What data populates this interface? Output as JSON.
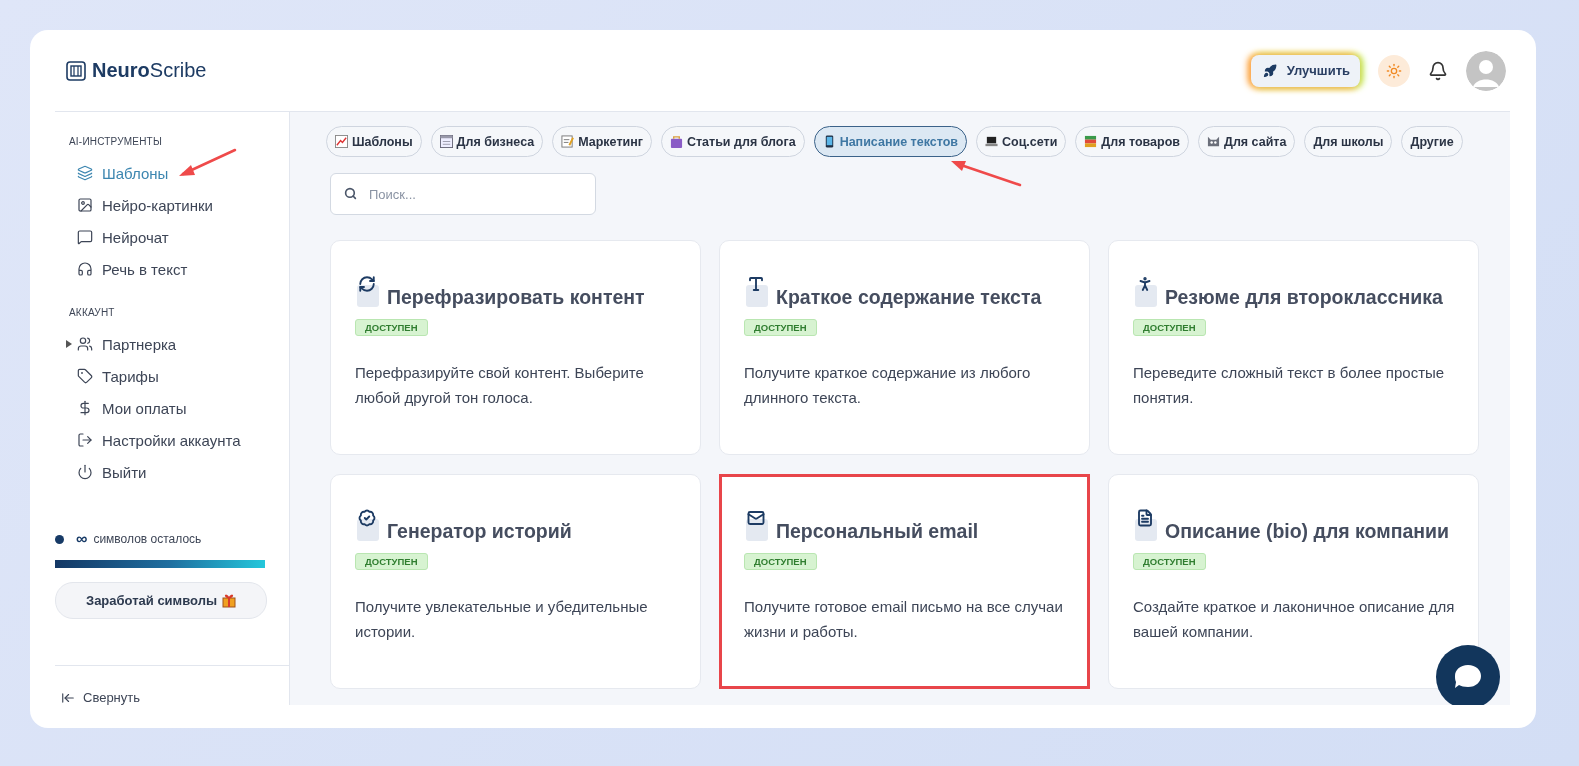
{
  "header": {
    "logo": "**Neuro**Scribe",
    "upgrade_button": "Улучшить"
  },
  "sidebar": {
    "sections": [
      {
        "title": "AI-ИНСТРУМЕНТЫ",
        "items": [
          {
            "label": "Шаблоны",
            "selected": true,
            "annotated": true
          },
          {
            "label": "Нейро-картинки",
            "selected": false,
            "annotated": false
          },
          {
            "label": "Нейрочат",
            "selected": false,
            "annotated": false
          },
          {
            "label": "Речь в текст",
            "selected": false,
            "annotated": false
          }
        ]
      },
      {
        "title": "АККАУНТ",
        "items": [
          {
            "label": "Партнерка",
            "selected": false,
            "annotated": false,
            "expanded": false
          },
          {
            "label": "Тарифы",
            "selected": false,
            "annotated": false
          },
          {
            "label": "Мои оплаты",
            "selected": false,
            "annotated": false
          },
          {
            "label": "Настройки аккаунта",
            "selected": false,
            "annotated": false
          },
          {
            "label": "Выйти",
            "selected": false,
            "annotated": false
          }
        ]
      }
    ],
    "credits": {
      "amount": "∞",
      "label": "символов осталось",
      "level": 1
    },
    "earn_button": "Заработай символы",
    "collapse": "Свернуть"
  },
  "tabs": [
    {
      "label": "Шаблоны",
      "selected": false,
      "annotated": false
    },
    {
      "label": "Для бизнеса",
      "selected": false,
      "annotated": false
    },
    {
      "label": "Маркетинг",
      "selected": false,
      "annotated": false
    },
    {
      "label": "Статьи для блога",
      "selected": false,
      "annotated": false
    },
    {
      "label": "Написание текстов",
      "selected": true,
      "annotated": true
    },
    {
      "label": "Соц.сети",
      "selected": false,
      "annotated": false
    },
    {
      "label": "Для товаров",
      "selected": false,
      "annotated": false
    },
    {
      "label": "Для сайта",
      "selected": false,
      "annotated": false
    },
    {
      "label": "Для школы",
      "selected": false,
      "annotated": false
    },
    {
      "label": "Другие",
      "selected": false,
      "annotated": false
    }
  ],
  "search": {
    "placeholder": "Поиск..."
  },
  "cards": [
    {
      "title": "Перефразировать контент",
      "badge": "ДОСТУПЕН",
      "description": "Перефразируйте свой контент. Выберите любой другой тон голоса.",
      "highlighted": false
    },
    {
      "title": "Краткое содержание текста",
      "badge": "ДОСТУПЕН",
      "description": "Получите краткое содержание из любого длинного текста.",
      "highlighted": false
    },
    {
      "title": "Резюме для второклассника",
      "badge": "ДОСТУПЕН",
      "description": "Переведите сложный текст в более простые понятия.",
      "highlighted": false
    },
    {
      "title": "Генератор историй",
      "badge": "ДОСТУПЕН",
      "description": "Получите увлекательные и убедительные истории.",
      "highlighted": false
    },
    {
      "title": "Персональный email",
      "badge": "ДОСТУПЕН",
      "description": "Получите готовое email письмо на все случаи жизни и работы.",
      "highlighted": true
    },
    {
      "title": "Описание (bio) для компании",
      "badge": "ДОСТУПЕН",
      "description": "Создайте краткое и лаконичное описание для вашей компании.",
      "highlighted": false
    }
  ]
}
